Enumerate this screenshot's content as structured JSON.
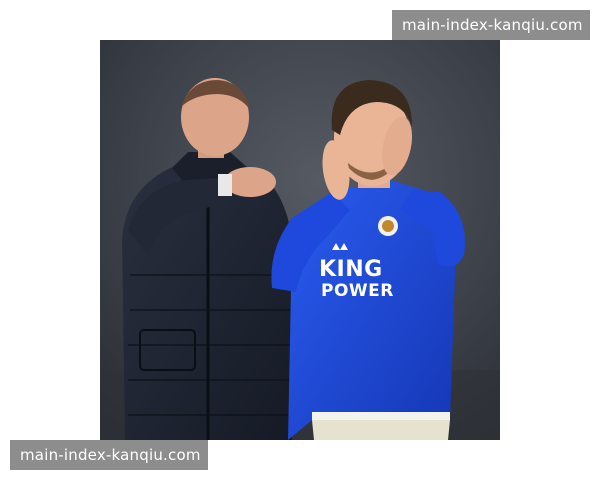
{
  "watermarks": {
    "top": "main-index-kanqiu.com",
    "bottom": "main-index-kanqiu.com"
  },
  "photo": {
    "jersey_sponsor": "KING POWER",
    "colors": {
      "background": "#3a3d44",
      "jersey": "#1d46d6",
      "jacket": "#1c2230",
      "shorts": "#e6e2cf",
      "watermark_bg": "#8d8d8d"
    }
  }
}
